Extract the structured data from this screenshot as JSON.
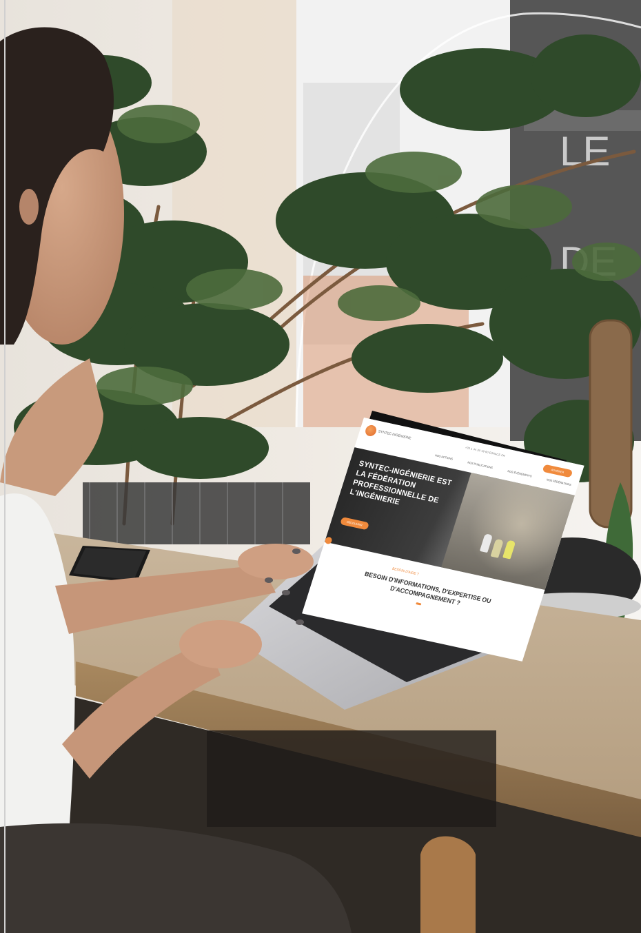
{
  "scene": {
    "description_free": true
  },
  "website": {
    "logo_text": "SYNTEC INGÉNIERIE",
    "top_links": "+33 1 44 30 49 60   ESPACE   FR",
    "cta_label": "ADHÉRER",
    "nav_items": [
      "NOS ACTIONS",
      "NOS PUBLICATIONS",
      "NOS ÉVÈNEMENTS",
      "NOS FÉDÉRATIONS"
    ],
    "hero_title": "SYNTEC-INGÉNIERIE EST LA FÉDÉRATION PROFESSIONNELLE DE L'INGÉNIERIE",
    "hero_subtitle": "",
    "hero_button": "DÉCOUVRIR",
    "section_label": "BESOIN D'AIDE ?",
    "section_title": "BESOIN D'INFORMATIONS, D'EXPERTISE OU D'ACCOMPAGNEMENT ?"
  },
  "colors": {
    "accent": "#f08a3c",
    "hero_dark": "#2a2a2a"
  }
}
